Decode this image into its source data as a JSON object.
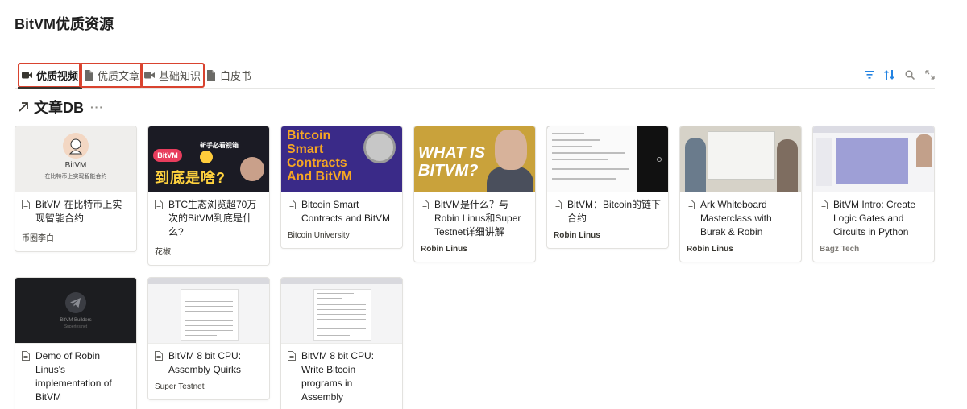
{
  "page_title": "BitVM优质资源",
  "tabs": [
    {
      "label": "优质视频",
      "icon": "video-icon",
      "active": true,
      "highlight": true
    },
    {
      "label": "优质文章",
      "icon": "document-icon",
      "active": false,
      "highlight": true
    },
    {
      "label": "基础知识",
      "icon": "video-icon",
      "active": false,
      "highlight": true
    },
    {
      "label": "白皮书",
      "icon": "document-icon",
      "active": false,
      "highlight": false
    }
  ],
  "toolbar": [
    "filter-icon",
    "sort-icon",
    "search-icon",
    "expand-icon"
  ],
  "database": {
    "title": "文章DB",
    "more": "···"
  },
  "thumbs": {
    "t1_name": "BitVM",
    "t1_sub": "在比特币上实现智能合约",
    "t2_pill": "BitVM",
    "t2_big": "到底是啥?",
    "t2_tag": "新手必看视箱",
    "t3_text": "Bitcoin Smart Contracts And BitVM",
    "t4_text": "WHAT IS BITVM?",
    "t8_s1": "BitVM Builders",
    "t8_s2": "Supertestnet"
  },
  "cards": [
    {
      "title": "BitVM 在比特币上实现智能合约",
      "meta": "币圈李白",
      "meta_style": "normal"
    },
    {
      "title": "BTC生态浏览超70万次的BitVM到底是什么?",
      "meta": "花椒",
      "meta_style": "normal"
    },
    {
      "title": "Bitcoin Smart Contracts and BitVM",
      "meta": "Bitcoin University",
      "meta_style": "normal"
    },
    {
      "title": "BitVM是什么？与Robin Linus和Super Testnet详细讲解",
      "meta": "Robin Linus",
      "meta_style": "bold"
    },
    {
      "title": "BitVM：Bitcoin的链下合约",
      "meta": "Robin Linus",
      "meta_style": "bold"
    },
    {
      "title": "Ark Whiteboard Masterclass with Burak & Robin",
      "meta": "Robin Linus",
      "meta_style": "bold"
    },
    {
      "title": "BitVM Intro: Create Logic Gates and Circuits in Python",
      "meta": "Bagz Tech",
      "meta_style": "muted"
    },
    {
      "title": "Demo of Robin Linus's implementation of BitVM",
      "meta": "",
      "meta_style": "normal"
    },
    {
      "title": "BitVM 8 bit CPU: Assembly Quirks",
      "meta": "Super Testnet",
      "meta_style": "normal"
    },
    {
      "title": "BitVM 8 bit CPU: Write Bitcoin programs in Assembly",
      "meta": "",
      "meta_style": "normal"
    }
  ]
}
